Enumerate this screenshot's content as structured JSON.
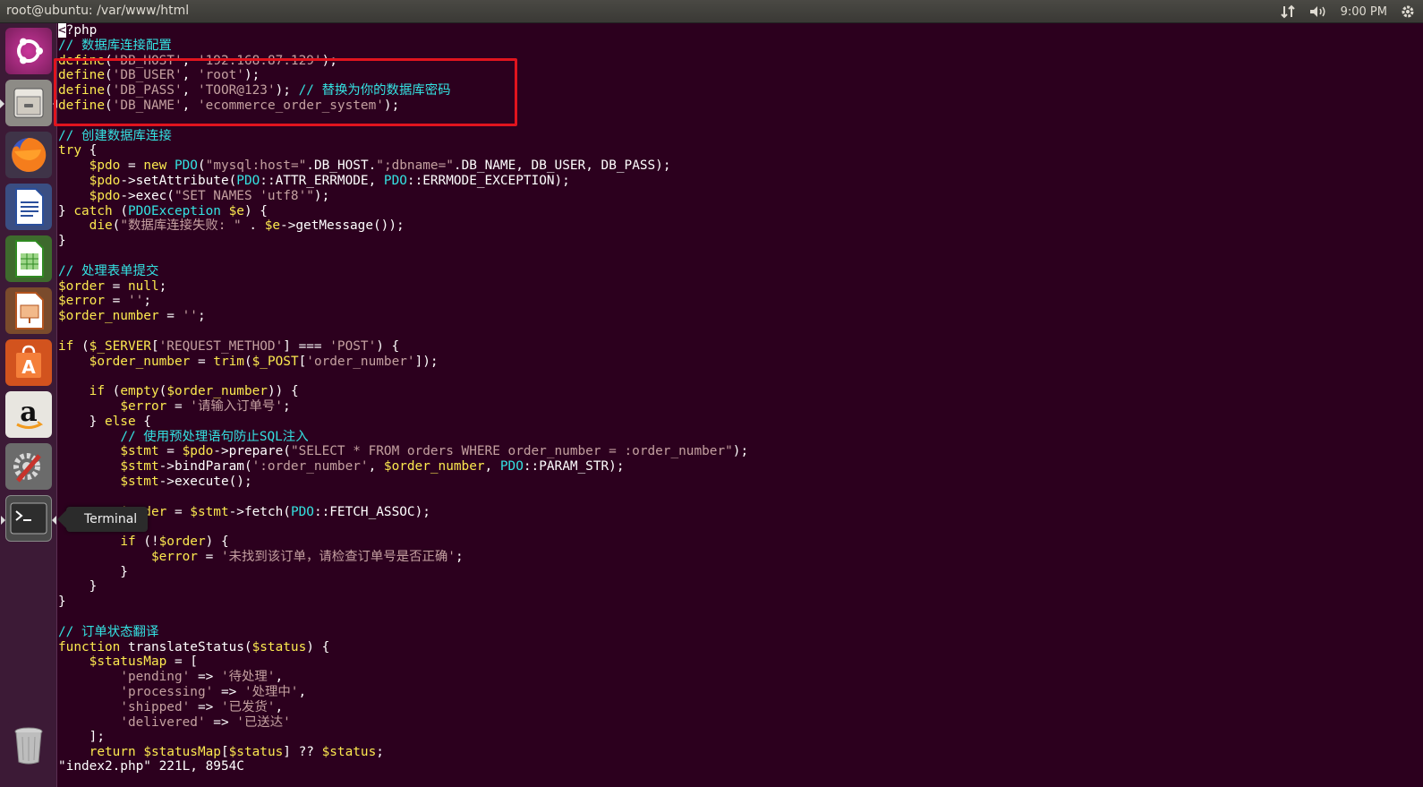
{
  "window": {
    "title": "root@ubuntu: /var/www/html"
  },
  "panel": {
    "clock": "9:00 PM",
    "icons": [
      "network-arrows-icon",
      "volume-icon",
      "gear-icon"
    ]
  },
  "launcher": {
    "items": [
      {
        "name": "ubuntu-dash",
        "icon": "ubuntu-logo-icon"
      },
      {
        "name": "files",
        "icon": "file-cabinet-icon"
      },
      {
        "name": "firefox",
        "icon": "firefox-icon"
      },
      {
        "name": "libreoffice-writer",
        "icon": "writer-icon"
      },
      {
        "name": "libreoffice-calc",
        "icon": "calc-icon"
      },
      {
        "name": "libreoffice-impress",
        "icon": "impress-icon"
      },
      {
        "name": "ubuntu-software",
        "icon": "shopping-bag-icon"
      },
      {
        "name": "amazon",
        "icon": "amazon-icon"
      },
      {
        "name": "system-settings",
        "icon": "settings-wrench-icon"
      },
      {
        "name": "terminal",
        "icon": "terminal-icon"
      },
      {
        "name": "trash",
        "icon": "trash-icon"
      }
    ],
    "tooltip": "Terminal"
  },
  "editor": {
    "lines": [
      "<?php",
      "// 数据库连接配置",
      "define('DB_HOST', '192.168.87.129');",
      "define('DB_USER', 'root');",
      "define('DB_PASS', 'TOOR@123'); // 替换为你的数据库密码",
      "define('DB_NAME', 'ecommerce_order_system');",
      "",
      "// 创建数据库连接",
      "try {",
      "    $pdo = new PDO(\"mysql:host=\".DB_HOST.\";dbname=\".DB_NAME, DB_USER, DB_PASS);",
      "    $pdo->setAttribute(PDO::ATTR_ERRMODE, PDO::ERRMODE_EXCEPTION);",
      "    $pdo->exec(\"SET NAMES 'utf8'\");",
      "} catch (PDOException $e) {",
      "    die(\"数据库连接失败: \" . $e->getMessage());",
      "}",
      "",
      "// 处理表单提交",
      "$order = null;",
      "$error = '';",
      "$order_number = '';",
      "",
      "if ($_SERVER['REQUEST_METHOD'] === 'POST') {",
      "    $order_number = trim($_POST['order_number']);",
      "",
      "    if (empty($order_number)) {",
      "        $error = '请输入订单号';",
      "    } else {",
      "        // 使用预处理语句防止SQL注入",
      "        $stmt = $pdo->prepare(\"SELECT * FROM orders WHERE order_number = :order_number\");",
      "        $stmt->bindParam(':order_number', $order_number, PDO::PARAM_STR);",
      "        $stmt->execute();",
      "",
      "        $order = $stmt->fetch(PDO::FETCH_ASSOC);",
      "",
      "        if (!$order) {",
      "            $error = '未找到该订单，请检查订单号是否正确';",
      "        }",
      "    }",
      "}",
      "",
      "// 订单状态翻译",
      "function translateStatus($status) {",
      "    $statusMap = [",
      "        'pending' => '待处理',",
      "        'processing' => '处理中',",
      "        'shipped' => '已发货',",
      "        'delivered' => '已送达'",
      "    ];",
      "    return $statusMap[$status] ?? $status;"
    ],
    "status_line": "\"index2.php\" 221L, 8954C"
  }
}
